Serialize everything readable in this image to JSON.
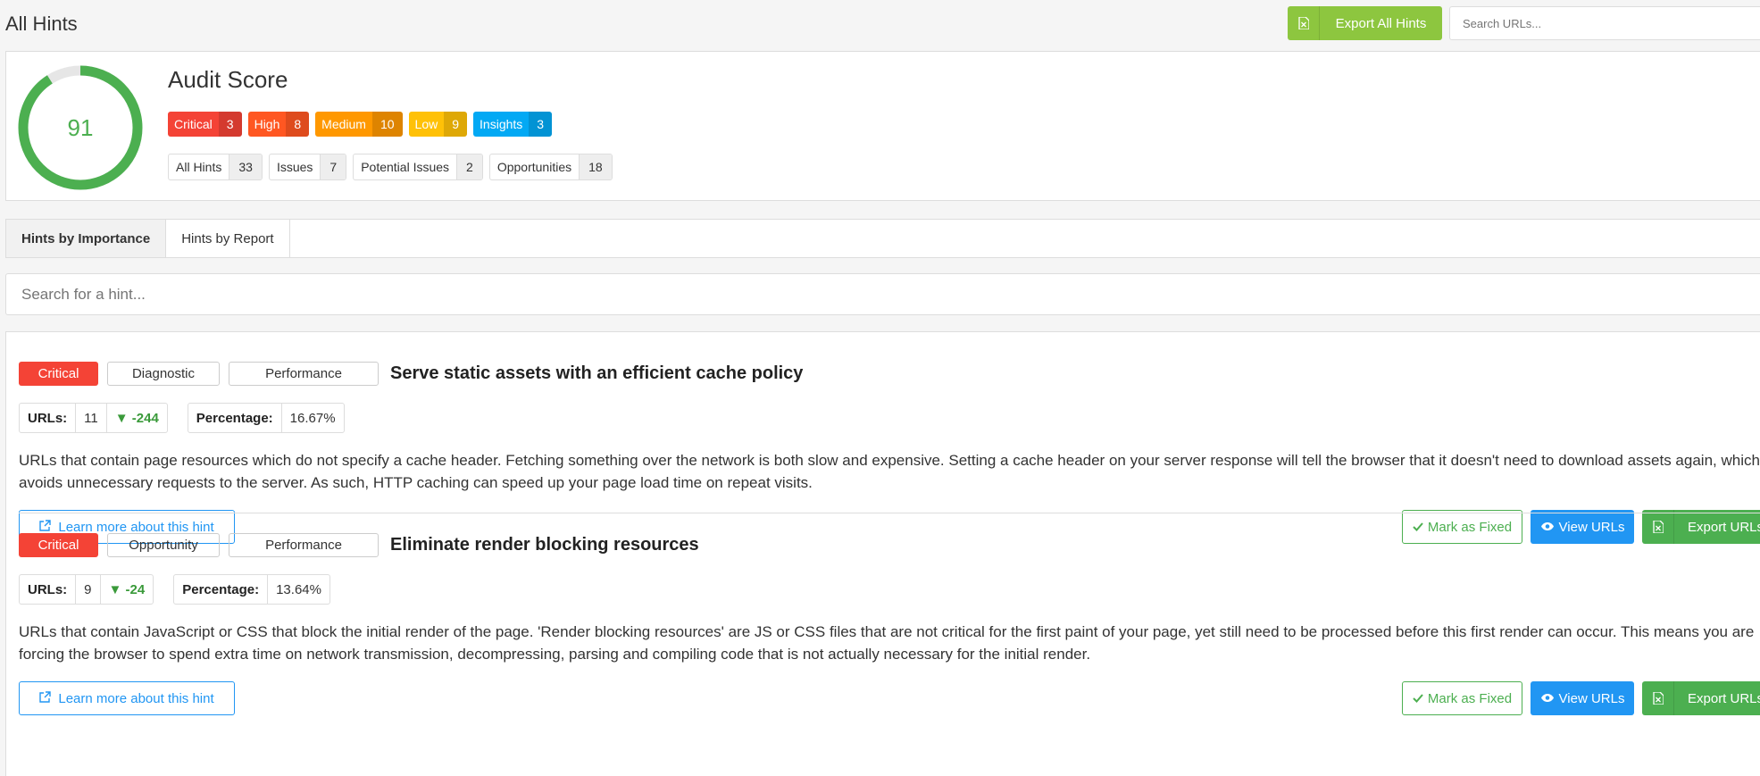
{
  "header": {
    "title": "All Hints",
    "export_all_label": "Export All Hints",
    "search_placeholder": "Search URLs..."
  },
  "audit": {
    "title": "Audit Score",
    "score": "91",
    "score_fraction": 0.91,
    "score_color": "#4caf50",
    "severities": [
      {
        "label": "Critical",
        "count": "3",
        "color": "#f44336"
      },
      {
        "label": "High",
        "count": "8",
        "color": "#ff5722"
      },
      {
        "label": "Medium",
        "count": "10",
        "color": "#ff9800"
      },
      {
        "label": "Low",
        "count": "9",
        "color": "#ffc107"
      },
      {
        "label": "Insights",
        "count": "3",
        "color": "#03a9f4"
      }
    ],
    "counts": [
      {
        "label": "All Hints",
        "count": "33"
      },
      {
        "label": "Issues",
        "count": "7"
      },
      {
        "label": "Potential Issues",
        "count": "2"
      },
      {
        "label": "Opportunities",
        "count": "18"
      }
    ]
  },
  "tabs": [
    {
      "label": "Hints by Importance",
      "active": true
    },
    {
      "label": "Hints by Report",
      "active": false
    }
  ],
  "hint_search_placeholder": "Search for a hint...",
  "hints": [
    {
      "severity": "Critical",
      "category": "Diagnostic",
      "type": "Performance",
      "title": "Serve static assets with an efficient cache policy",
      "urls_label": "URLs:",
      "urls": "11",
      "delta": "▼ -244",
      "percentage_label": "Percentage:",
      "percentage": "16.67%",
      "description": "URLs that contain page resources which do not specify a cache header. Fetching something over the network is both slow and expensive. Setting a cache header on your server response will tell the browser that it doesn't need to download assets again, which avoids unnecessary requests to the server. As such, HTTP caching can speed up your page load time on repeat visits.",
      "learn_label": "Learn more about this hint",
      "mark_fixed_label": "Mark as Fixed",
      "view_urls_label": "View URLs",
      "export_urls_label": "Export URLs"
    },
    {
      "severity": "Critical",
      "category": "Opportunity",
      "type": "Performance",
      "title": "Eliminate render blocking resources",
      "urls_label": "URLs:",
      "urls": "9",
      "delta": "▼ -24",
      "percentage_label": "Percentage:",
      "percentage": "13.64%",
      "description": "URLs that contain JavaScript or CSS that block the initial render of the page. 'Render blocking resources' are JS or CSS files that are not critical for the first paint of your page, yet still need to be processed before this first render can occur. This means you are forcing the browser to spend extra time on network transmission, decompressing, parsing and compiling code that is not actually necessary for the initial render.",
      "learn_label": "Learn more about this hint",
      "mark_fixed_label": "Mark as Fixed",
      "view_urls_label": "View URLs",
      "export_urls_label": "Export URLs"
    }
  ]
}
